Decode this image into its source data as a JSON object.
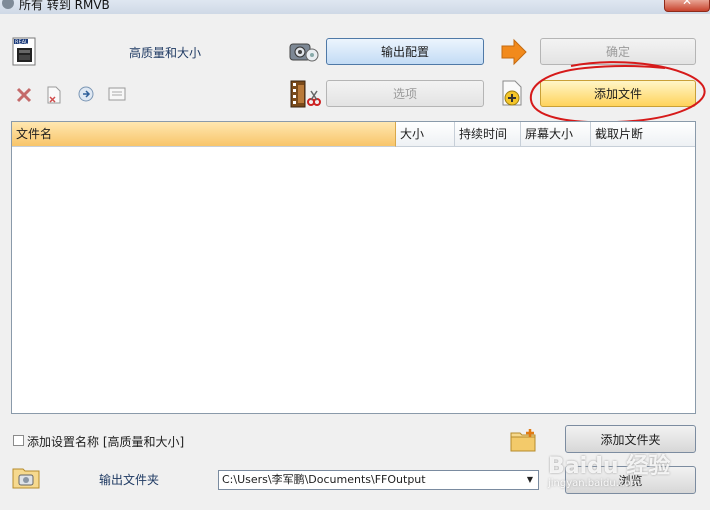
{
  "window": {
    "title": "所有 转到 RMVB"
  },
  "profile": {
    "label": "高质量和大小",
    "config_button": "输出配置"
  },
  "actions": {
    "ok_button": "确定",
    "options_button": "选项",
    "add_file_button": "添加文件"
  },
  "file_list": {
    "columns": [
      "文件名",
      "大小",
      "持续时间",
      "屏幕大小",
      "截取片断"
    ]
  },
  "footer": {
    "add_setting_name_label": "添加设置名称 [高质量和大小]",
    "add_folder_button": "添加文件夹",
    "output_folder_label": "输出文件夹",
    "output_folder_path": "C:\\Users\\李军鹏\\Documents\\FFOutput",
    "browse_button": "浏览"
  },
  "watermark": {
    "brand": "Baidu 经验",
    "url": "jingyan.baidu.com"
  },
  "colors": {
    "annotation_circle": "#d61a1a",
    "active_column": "#f8c56a",
    "add_file_highlight": "#ffd35c"
  }
}
